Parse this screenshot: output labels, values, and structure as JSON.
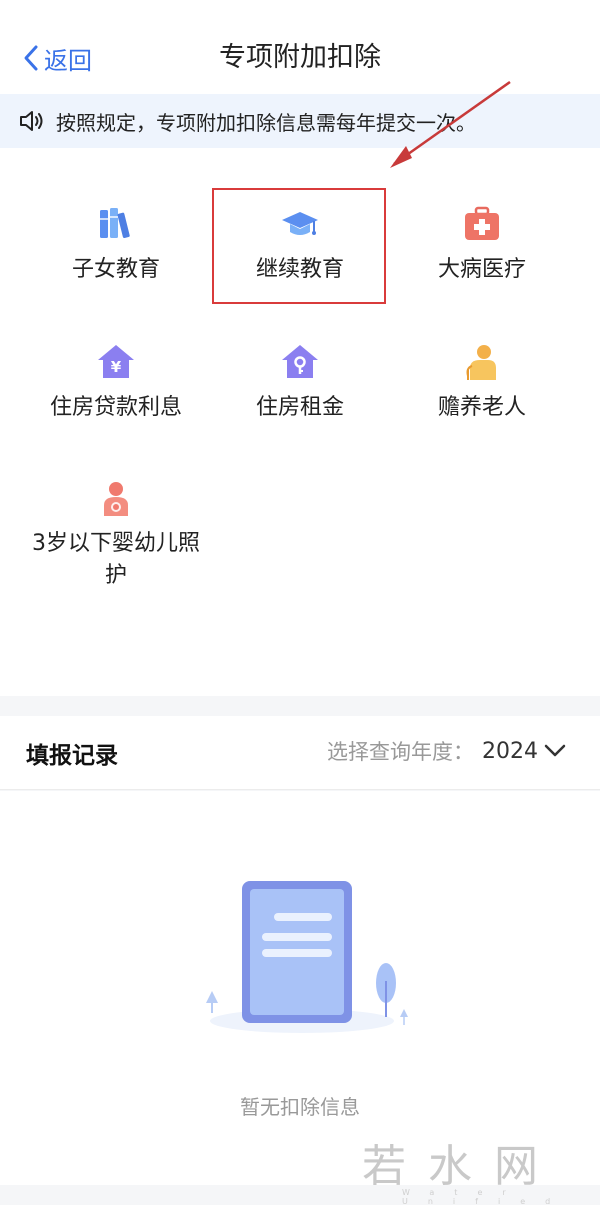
{
  "nav": {
    "back_label": "返回",
    "title": "专项附加扣除"
  },
  "notice": {
    "text": "按照规定，专项附加扣除信息需每年提交一次。"
  },
  "categories": [
    {
      "label": "子女教育",
      "icon": "books-icon"
    },
    {
      "label": "继续教育",
      "icon": "graduation-cap-icon"
    },
    {
      "label": "大病医疗",
      "icon": "medical-kit-icon"
    },
    {
      "label": "住房贷款利息",
      "icon": "house-yuan-icon"
    },
    {
      "label": "住房租金",
      "icon": "house-key-icon"
    },
    {
      "label": "赡养老人",
      "icon": "elder-icon"
    },
    {
      "label": "3岁以下婴幼儿照护",
      "icon": "mother-baby-icon"
    }
  ],
  "records": {
    "title": "填报记录",
    "year_label": "选择查询年度：",
    "year_value": "2024"
  },
  "empty": {
    "text": "暂无扣除信息"
  },
  "watermark": {
    "text": "若水网",
    "small": "Water Unified Network"
  },
  "colors": {
    "accent": "#3a72e8",
    "highlight": "#d93b3b",
    "arrow": "#c83a3a"
  }
}
